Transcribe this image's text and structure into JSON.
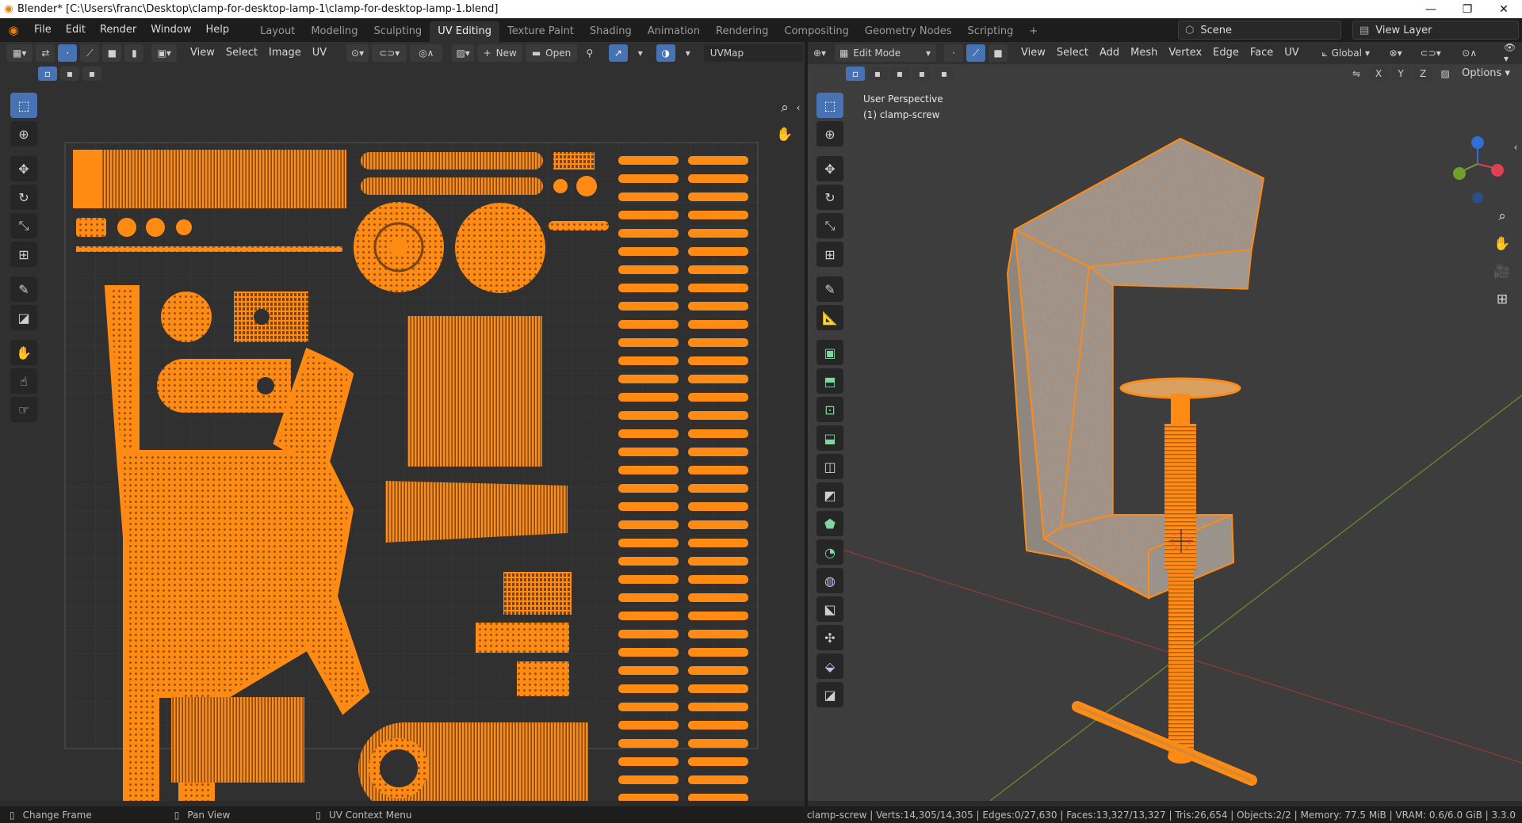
{
  "window": {
    "title": "Blender* [C:\\Users\\franc\\Desktop\\clamp-for-desktop-lamp-1\\clamp-for-desktop-lamp-1.blend]",
    "minimize": "—",
    "maximize": "❐",
    "close": "✕"
  },
  "menu": [
    "File",
    "Edit",
    "Render",
    "Window",
    "Help"
  ],
  "workspaces": [
    "Layout",
    "Modeling",
    "Sculpting",
    "UV Editing",
    "Texture Paint",
    "Shading",
    "Animation",
    "Rendering",
    "Compositing",
    "Geometry Nodes",
    "Scripting",
    "+"
  ],
  "active_workspace": "UV Editing",
  "scene": {
    "label": "Scene",
    "view_layer": "View Layer"
  },
  "uv_editor": {
    "header": [
      "View",
      "Select",
      "Image",
      "UV"
    ],
    "new_label": "New",
    "open_label": "Open",
    "uvmap": "UVMap"
  },
  "viewport": {
    "mode": "Edit Mode",
    "header": [
      "View",
      "Select",
      "Add",
      "Mesh",
      "Vertex",
      "Edge",
      "Face",
      "UV"
    ],
    "transform_orientation": "Global",
    "axes": [
      "X",
      "Y",
      "Z"
    ],
    "options_label": "Options",
    "perspective": "User Perspective",
    "object_label": "(1) clamp-screw"
  },
  "status": {
    "left": [
      "Change Frame",
      "Pan View",
      "UV Context Menu"
    ],
    "right": "clamp-screw | Verts:14,305/14,305 | Edges:0/27,630 | Faces:13,327/13,327 | Tris:26,654 | Objects:2/2 | Memory: 77.5 MiB | VRAM: 0.6/6.0 GiB | 3.3.0"
  },
  "colors": {
    "accent": "#4772b3",
    "selection": "#ff8a14",
    "background": "#303030"
  }
}
